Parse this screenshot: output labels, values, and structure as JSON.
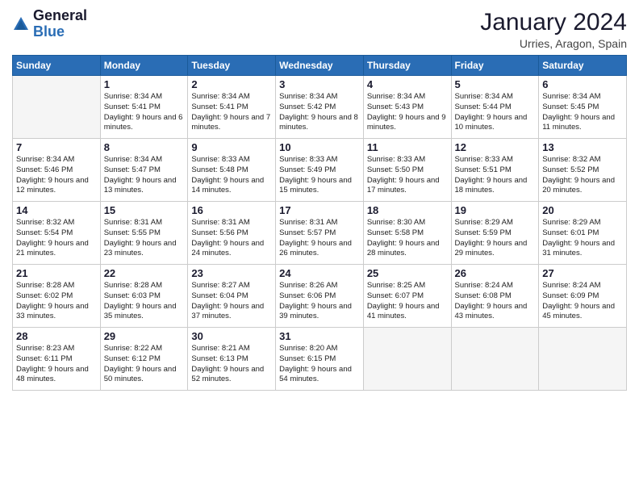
{
  "logo": {
    "general": "General",
    "blue": "Blue"
  },
  "header": {
    "month_year": "January 2024",
    "location": "Urries, Aragon, Spain"
  },
  "days_of_week": [
    "Sunday",
    "Monday",
    "Tuesday",
    "Wednesday",
    "Thursday",
    "Friday",
    "Saturday"
  ],
  "weeks": [
    [
      {
        "day": null,
        "info": null
      },
      {
        "day": "1",
        "sunrise": "8:34 AM",
        "sunset": "5:41 PM",
        "daylight": "9 hours and 6 minutes."
      },
      {
        "day": "2",
        "sunrise": "8:34 AM",
        "sunset": "5:41 PM",
        "daylight": "9 hours and 7 minutes."
      },
      {
        "day": "3",
        "sunrise": "8:34 AM",
        "sunset": "5:42 PM",
        "daylight": "9 hours and 8 minutes."
      },
      {
        "day": "4",
        "sunrise": "8:34 AM",
        "sunset": "5:43 PM",
        "daylight": "9 hours and 9 minutes."
      },
      {
        "day": "5",
        "sunrise": "8:34 AM",
        "sunset": "5:44 PM",
        "daylight": "9 hours and 10 minutes."
      },
      {
        "day": "6",
        "sunrise": "8:34 AM",
        "sunset": "5:45 PM",
        "daylight": "9 hours and 11 minutes."
      }
    ],
    [
      {
        "day": "7",
        "sunrise": "8:34 AM",
        "sunset": "5:46 PM",
        "daylight": "9 hours and 12 minutes."
      },
      {
        "day": "8",
        "sunrise": "8:34 AM",
        "sunset": "5:47 PM",
        "daylight": "9 hours and 13 minutes."
      },
      {
        "day": "9",
        "sunrise": "8:33 AM",
        "sunset": "5:48 PM",
        "daylight": "9 hours and 14 minutes."
      },
      {
        "day": "10",
        "sunrise": "8:33 AM",
        "sunset": "5:49 PM",
        "daylight": "9 hours and 15 minutes."
      },
      {
        "day": "11",
        "sunrise": "8:33 AM",
        "sunset": "5:50 PM",
        "daylight": "9 hours and 17 minutes."
      },
      {
        "day": "12",
        "sunrise": "8:33 AM",
        "sunset": "5:51 PM",
        "daylight": "9 hours and 18 minutes."
      },
      {
        "day": "13",
        "sunrise": "8:32 AM",
        "sunset": "5:52 PM",
        "daylight": "9 hours and 20 minutes."
      }
    ],
    [
      {
        "day": "14",
        "sunrise": "8:32 AM",
        "sunset": "5:54 PM",
        "daylight": "9 hours and 21 minutes."
      },
      {
        "day": "15",
        "sunrise": "8:31 AM",
        "sunset": "5:55 PM",
        "daylight": "9 hours and 23 minutes."
      },
      {
        "day": "16",
        "sunrise": "8:31 AM",
        "sunset": "5:56 PM",
        "daylight": "9 hours and 24 minutes."
      },
      {
        "day": "17",
        "sunrise": "8:31 AM",
        "sunset": "5:57 PM",
        "daylight": "9 hours and 26 minutes."
      },
      {
        "day": "18",
        "sunrise": "8:30 AM",
        "sunset": "5:58 PM",
        "daylight": "9 hours and 28 minutes."
      },
      {
        "day": "19",
        "sunrise": "8:29 AM",
        "sunset": "5:59 PM",
        "daylight": "9 hours and 29 minutes."
      },
      {
        "day": "20",
        "sunrise": "8:29 AM",
        "sunset": "6:01 PM",
        "daylight": "9 hours and 31 minutes."
      }
    ],
    [
      {
        "day": "21",
        "sunrise": "8:28 AM",
        "sunset": "6:02 PM",
        "daylight": "9 hours and 33 minutes."
      },
      {
        "day": "22",
        "sunrise": "8:28 AM",
        "sunset": "6:03 PM",
        "daylight": "9 hours and 35 minutes."
      },
      {
        "day": "23",
        "sunrise": "8:27 AM",
        "sunset": "6:04 PM",
        "daylight": "9 hours and 37 minutes."
      },
      {
        "day": "24",
        "sunrise": "8:26 AM",
        "sunset": "6:06 PM",
        "daylight": "9 hours and 39 minutes."
      },
      {
        "day": "25",
        "sunrise": "8:25 AM",
        "sunset": "6:07 PM",
        "daylight": "9 hours and 41 minutes."
      },
      {
        "day": "26",
        "sunrise": "8:24 AM",
        "sunset": "6:08 PM",
        "daylight": "9 hours and 43 minutes."
      },
      {
        "day": "27",
        "sunrise": "8:24 AM",
        "sunset": "6:09 PM",
        "daylight": "9 hours and 45 minutes."
      }
    ],
    [
      {
        "day": "28",
        "sunrise": "8:23 AM",
        "sunset": "6:11 PM",
        "daylight": "9 hours and 48 minutes."
      },
      {
        "day": "29",
        "sunrise": "8:22 AM",
        "sunset": "6:12 PM",
        "daylight": "9 hours and 50 minutes."
      },
      {
        "day": "30",
        "sunrise": "8:21 AM",
        "sunset": "6:13 PM",
        "daylight": "9 hours and 52 minutes."
      },
      {
        "day": "31",
        "sunrise": "8:20 AM",
        "sunset": "6:15 PM",
        "daylight": "9 hours and 54 minutes."
      },
      {
        "day": null,
        "info": null
      },
      {
        "day": null,
        "info": null
      },
      {
        "day": null,
        "info": null
      }
    ]
  ],
  "labels": {
    "sunrise": "Sunrise:",
    "sunset": "Sunset:",
    "daylight": "Daylight:"
  }
}
